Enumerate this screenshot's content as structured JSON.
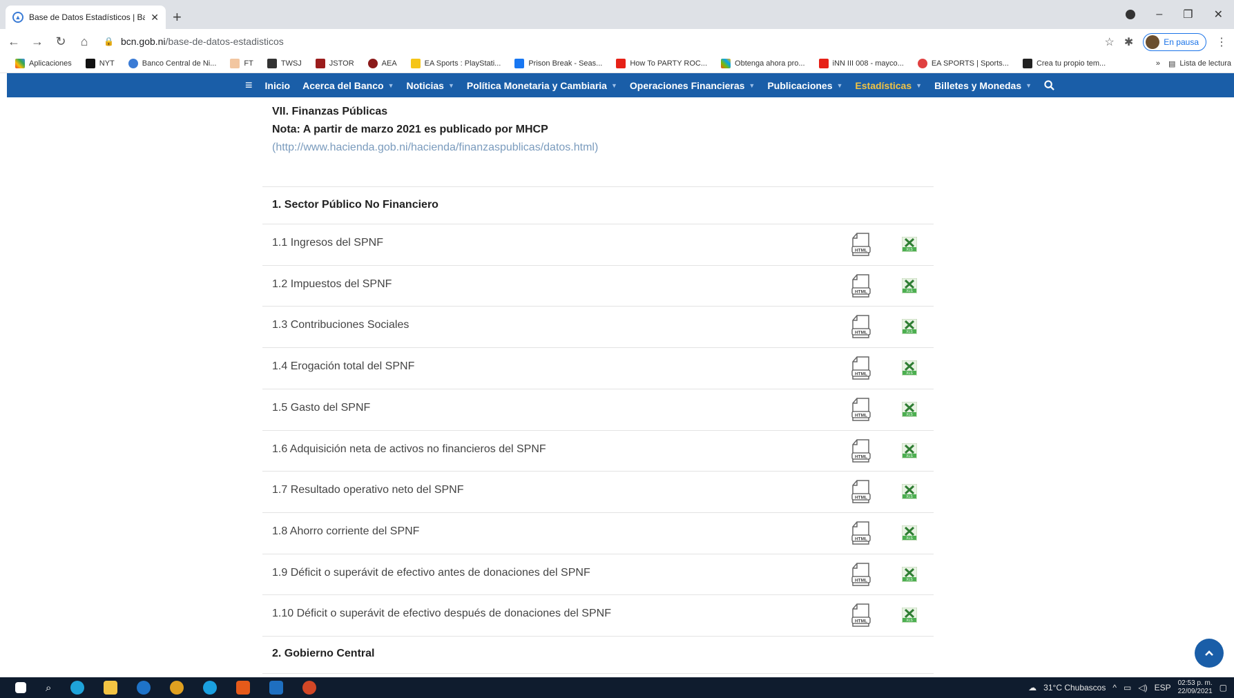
{
  "browser": {
    "tab_title": "Base de Datos Estadísticos | Banc",
    "new_tab": "+",
    "url_host": "bcn.gob.ni",
    "url_path": "/base-de-datos-estadisticos",
    "profile_status": "En pausa",
    "bookmarks": [
      "Aplicaciones",
      "NYT",
      "Banco Central de Ni...",
      "FT",
      "TWSJ",
      "JSTOR",
      "AEA",
      "EA Sports : PlayStati...",
      "Prison Break - Seas...",
      "How To PARTY ROC...",
      "Obtenga ahora pro...",
      "iNN III 008 - mayco...",
      "EA SPORTS | Sports...",
      "Crea tu propio tem..."
    ],
    "reading_list": "Lista de lectura",
    "more_bookmarks": "»"
  },
  "nav": {
    "menu_icon": "≡",
    "items": [
      {
        "label": "Inicio",
        "caret": false,
        "active": false
      },
      {
        "label": "Acerca del Banco",
        "caret": true,
        "active": false
      },
      {
        "label": "Noticias",
        "caret": true,
        "active": false
      },
      {
        "label": "Política Monetaria y Cambiaria",
        "caret": true,
        "active": false
      },
      {
        "label": "Operaciones Financieras",
        "caret": true,
        "active": false
      },
      {
        "label": "Publicaciones",
        "caret": true,
        "active": false
      },
      {
        "label": "Estadísticas",
        "caret": true,
        "active": true
      },
      {
        "label": "Billetes y Monedas",
        "caret": true,
        "active": false
      }
    ],
    "accent": "#f3c443",
    "bar_color": "#1a5ea8"
  },
  "section": {
    "title": "VII. Finanzas Públicas",
    "note": "Nota: A partir de marzo 2021 es publicado por MHCP",
    "link": "(http://www.hacienda.gob.ni/hacienda/finanzaspublicas/datos.html)"
  },
  "group1": {
    "heading": "1. Sector Público No Financiero",
    "rows": [
      {
        "label": "1.1 Ingresos del SPNF"
      },
      {
        "label": "1.2 Impuestos del SPNF"
      },
      {
        "label": "1.3 Contribuciones Sociales"
      },
      {
        "label": "1.4 Erogación total del SPNF"
      },
      {
        "label": "1.5 Gasto del SPNF"
      },
      {
        "label": "1.6 Adquisición neta de activos no financieros del SPNF"
      },
      {
        "label": "1.7 Resultado operativo neto del SPNF"
      },
      {
        "label": "1.8 Ahorro corriente del SPNF"
      },
      {
        "label": "1.9 Déficit o superávit de efectivo antes de donaciones del SPNF"
      },
      {
        "label": "1.10 Déficit o superávit de efectivo después de donaciones del SPNF"
      }
    ]
  },
  "group2": {
    "heading": "2. Gobierno Central"
  },
  "icons": {
    "html_label": "HTML",
    "xls_label": "XLS"
  },
  "taskbar": {
    "weather": "31°C  Chubascos",
    "lang": "ESP",
    "time": "02:53 p. m.",
    "date": "22/09/2021"
  }
}
